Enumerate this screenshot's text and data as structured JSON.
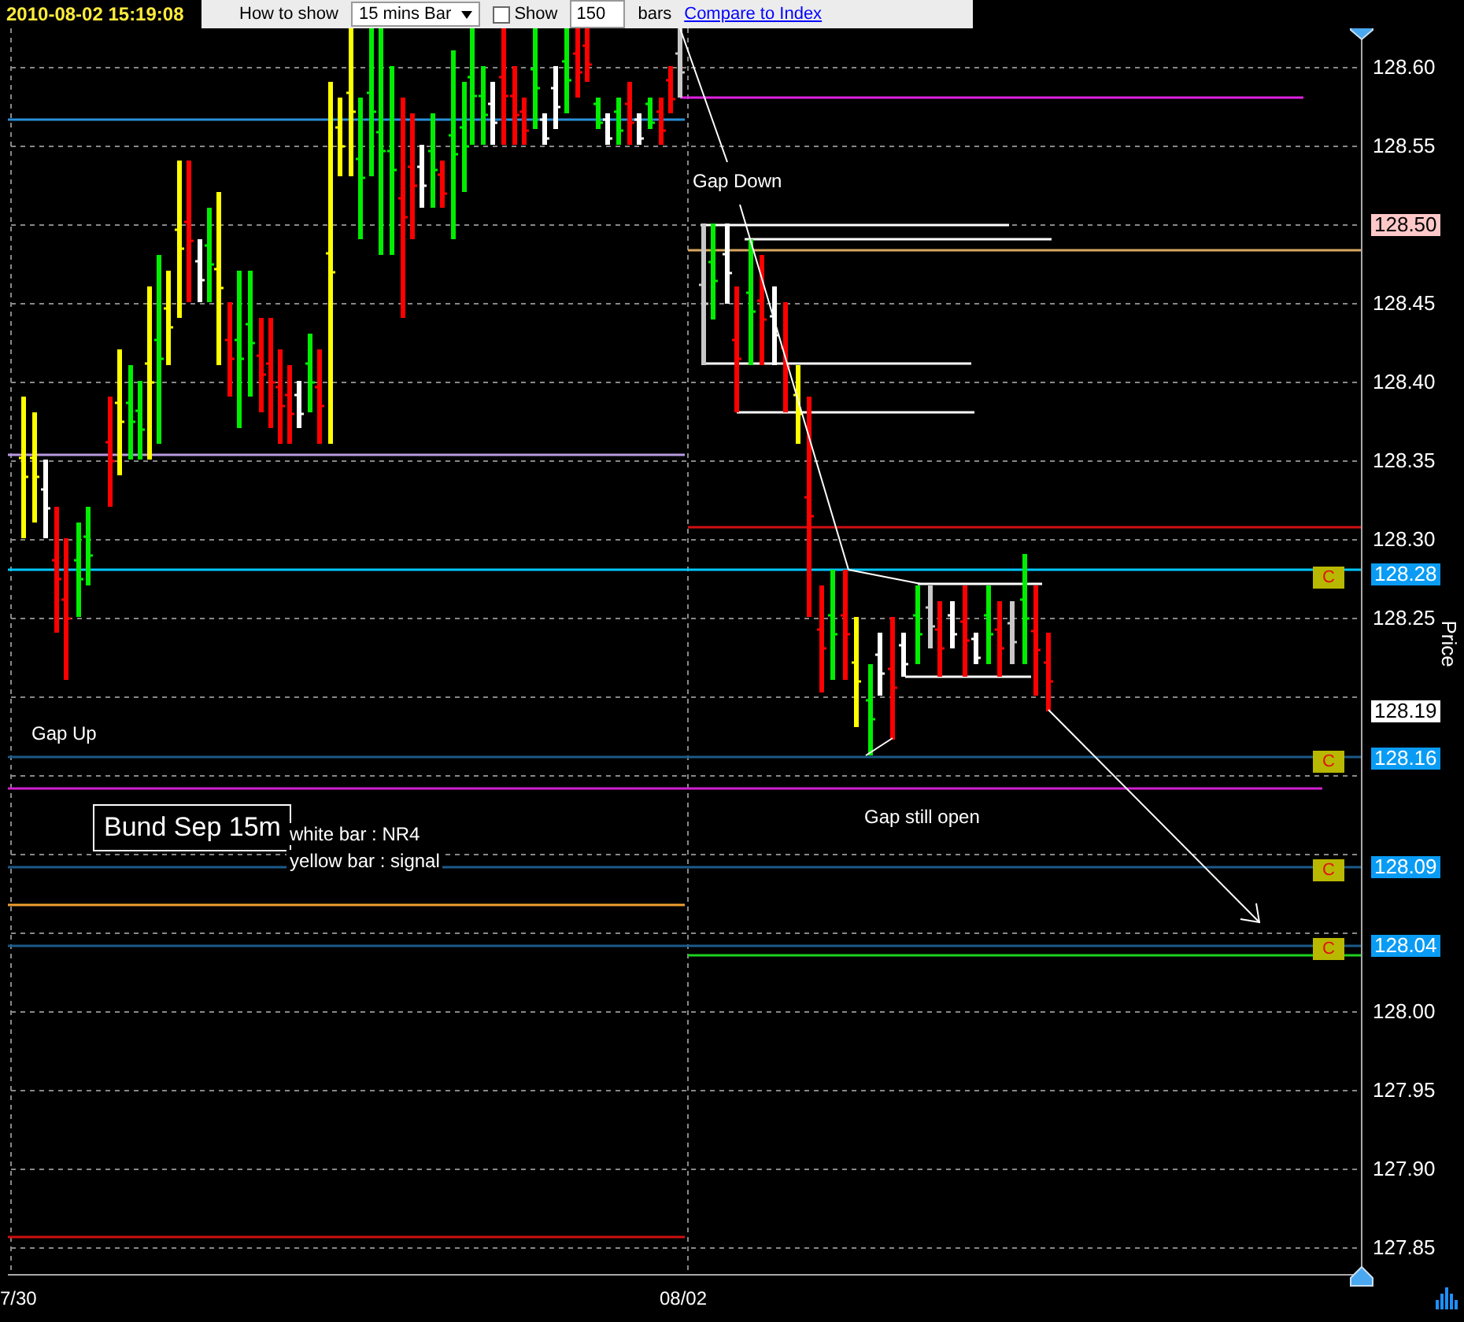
{
  "timestamp": "2010-08-02 15:19:08",
  "toolbar": {
    "show_label": "How to show",
    "interval": "15 mins Bar",
    "show_checkbox": {
      "label": "Show",
      "checked": false
    },
    "bars_count": "150",
    "bars_label": "bars",
    "compare_link": "Compare to Index"
  },
  "chart": {
    "instrument_label": "Bund Sep 15m",
    "legend": [
      "white bar : NR4",
      "yellow bar : signal"
    ],
    "annotations": [
      "Gap Up",
      "Gap Down",
      "Gap still open"
    ],
    "axis_title": "Price",
    "price_ticks": [
      "128.60",
      "128.55",
      "128.45",
      "128.40",
      "128.35",
      "128.30",
      "128.25",
      "128.00",
      "127.95",
      "127.90",
      "127.85"
    ],
    "price_tags": [
      {
        "value": "128.50",
        "kind": "high"
      },
      {
        "value": "128.28",
        "kind": "line",
        "marker": "C"
      },
      {
        "value": "128.19",
        "kind": "last"
      },
      {
        "value": "128.16",
        "kind": "line",
        "marker": "C"
      },
      {
        "value": "128.09",
        "kind": "line",
        "marker": "C"
      },
      {
        "value": "128.04",
        "kind": "line",
        "marker": "C"
      }
    ],
    "date_labels": [
      "7/30",
      "08/02"
    ]
  }
}
